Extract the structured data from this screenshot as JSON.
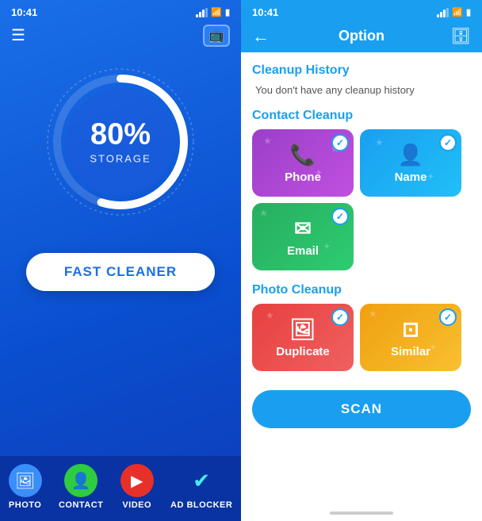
{
  "left": {
    "status_time": "10:41",
    "storage_percent": "80%",
    "storage_label": "STORAGE",
    "fast_cleaner_btn": "FAST CLEANER",
    "nav": [
      {
        "id": "photo",
        "label": "PHOTO",
        "icon": "🖼"
      },
      {
        "id": "contact",
        "label": "CONTACT",
        "icon": "👤"
      },
      {
        "id": "video",
        "label": "VIDEO",
        "icon": "▶"
      },
      {
        "id": "adblocker",
        "label": "AD BLOCKER",
        "icon": "✔"
      }
    ]
  },
  "right": {
    "status_time": "10:41",
    "option_title": "Option",
    "cleanup_history_title": "Cleanup History",
    "cleanup_history_empty": "You don't have any cleanup history",
    "contact_cleanup_title": "Contact Cleanup",
    "photo_cleanup_title": "Photo Cleanup",
    "cards": [
      {
        "id": "phone",
        "label": "Phone",
        "icon": "📞"
      },
      {
        "id": "name",
        "label": "Name",
        "icon": "👤"
      },
      {
        "id": "email",
        "label": "Email",
        "icon": "✉"
      },
      {
        "id": "duplicate",
        "label": "Duplicate",
        "icon": "🖼"
      },
      {
        "id": "similar",
        "label": "Similar",
        "icon": "⊡"
      }
    ],
    "scan_btn": "SCAN"
  }
}
